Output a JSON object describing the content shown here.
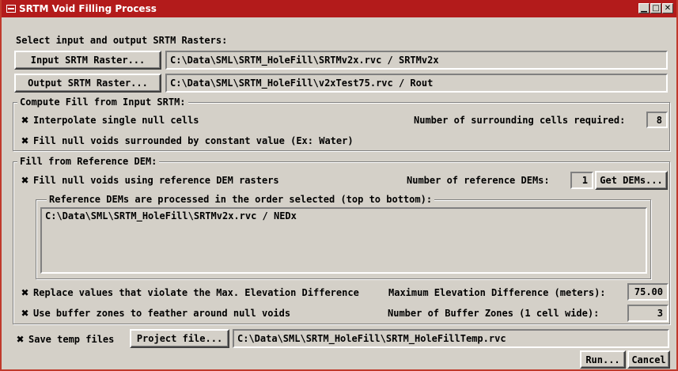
{
  "window": {
    "title": "SRTM Void Filling Process"
  },
  "io": {
    "heading": "Select input and output SRTM Rasters:",
    "input_button": "Input SRTM Raster...",
    "input_path": "C:\\Data\\SML\\SRTM_HoleFill\\SRTMv2x.rvc / SRTMv2x",
    "output_button": "Output SRTM Raster...",
    "output_path": "C:\\Data\\SML\\SRTM_HoleFill\\v2xTest75.rvc / Rout"
  },
  "compute": {
    "label": "Compute Fill from Input SRTM:",
    "interpolate_label": "Interpolate single null cells",
    "interpolate_checked": true,
    "surrounding_label": "Number of surrounding cells required:",
    "surrounding_value": "8",
    "constant_label": "Fill null voids surrounded by constant value (Ex: Water)",
    "constant_checked": true
  },
  "reference": {
    "label": "Fill from Reference DEM:",
    "fill_label": "Fill null voids using reference DEM rasters",
    "fill_checked": true,
    "count_label": "Number of reference DEMs:",
    "count_value": "1",
    "get_button": "Get DEMs...",
    "order_label": "Reference DEMs are processed in the order selected (top to bottom):",
    "items": [
      "C:\\Data\\SML\\SRTM_HoleFill\\SRTMv2x.rvc / NEDx"
    ],
    "replace_label": "Replace values that violate the Max. Elevation Difference",
    "replace_checked": true,
    "maxdiff_label": "Maximum Elevation Difference (meters):",
    "maxdiff_value": "75.00",
    "buffer_label": "Use buffer zones to feather around null voids",
    "buffer_checked": true,
    "zones_label": "Number of Buffer Zones (1 cell wide):",
    "zones_value": "3"
  },
  "temp": {
    "save_label": "Save temp files",
    "save_checked": true,
    "project_button": "Project file...",
    "project_path": "C:\\Data\\SML\\SRTM_HoleFill\\SRTM_HoleFillTemp.rvc"
  },
  "actions": {
    "run": "Run...",
    "cancel": "Cancel"
  },
  "icons": {
    "check_glyph": "✖",
    "minimize": "▁",
    "maximize": "□",
    "close": "✕"
  },
  "colors": {
    "titlebar": "#b31b1b",
    "face": "#d4d0c8"
  }
}
